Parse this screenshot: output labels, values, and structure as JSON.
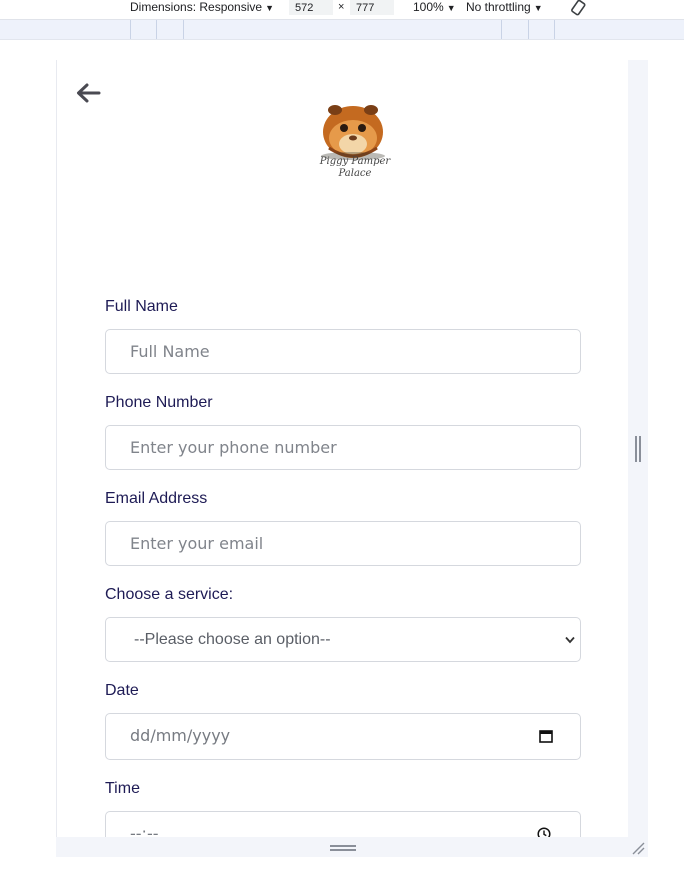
{
  "devtools": {
    "dimensions_label": "Dimensions: Responsive",
    "width": "572",
    "times": "×",
    "height": "777",
    "zoom": "100%",
    "throttling": "No throttling"
  },
  "page": {
    "logo": {
      "text_line1": "Piggy Pamper",
      "text_line2": "Palace"
    },
    "form": {
      "full_name": {
        "label": "Full Name",
        "placeholder": "Full Name"
      },
      "phone": {
        "label": "Phone Number",
        "placeholder": "Enter your phone number"
      },
      "email": {
        "label": "Email Address",
        "placeholder": "Enter your email"
      },
      "service": {
        "label": "Choose a service:",
        "selected": "--Please choose an option--"
      },
      "date": {
        "label": "Date",
        "placeholder": "dd/mm/yyyy"
      },
      "time": {
        "label": "Time",
        "placeholder": "--:--"
      }
    }
  },
  "colors": {
    "label": "#1e1b55",
    "border": "#d5d8de",
    "placeholder": "#80848b"
  }
}
